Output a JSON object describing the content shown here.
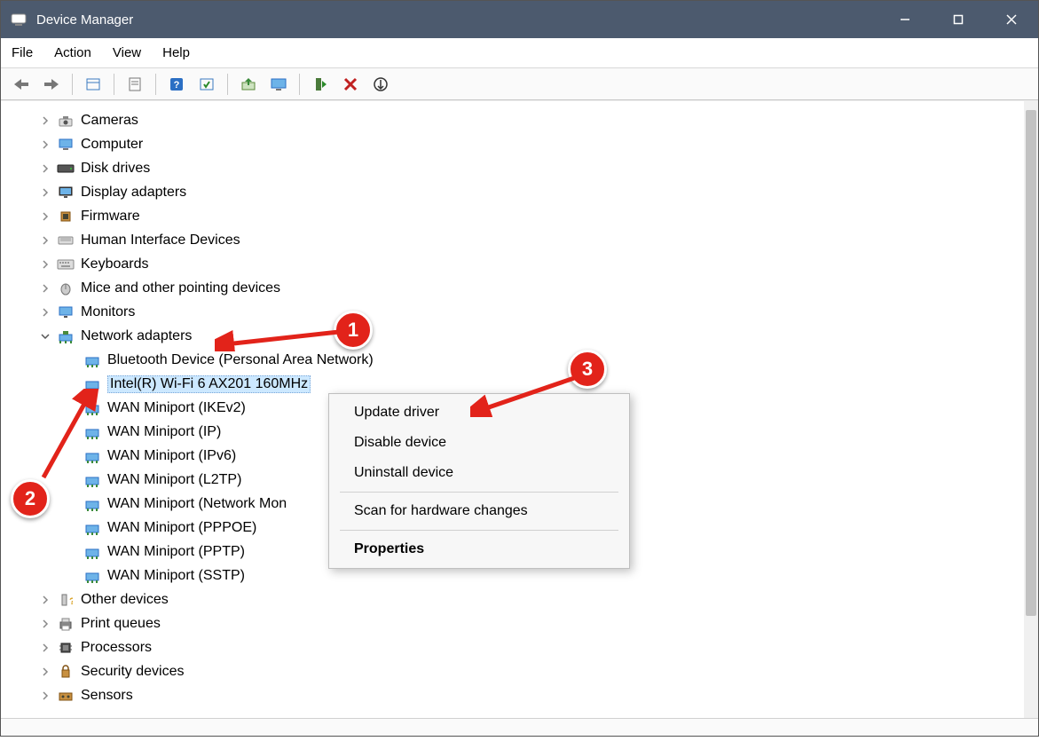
{
  "window": {
    "title": "Device Manager"
  },
  "menu": {
    "file": "File",
    "action": "Action",
    "view": "View",
    "help": "Help"
  },
  "toolbar_icons": [
    "back",
    "forward",
    "show-hidden",
    "properties",
    "help",
    "scan",
    "update-driver",
    "computer",
    "enable",
    "uninstall",
    "events"
  ],
  "tree": {
    "categories": [
      {
        "label": "Cameras",
        "icon": "camera",
        "expandable": true
      },
      {
        "label": "Computer",
        "icon": "computer",
        "expandable": true
      },
      {
        "label": "Disk drives",
        "icon": "disk",
        "expandable": true
      },
      {
        "label": "Display adapters",
        "icon": "display",
        "expandable": true
      },
      {
        "label": "Firmware",
        "icon": "firmware",
        "expandable": true
      },
      {
        "label": "Human Interface Devices",
        "icon": "hid",
        "expandable": true
      },
      {
        "label": "Keyboards",
        "icon": "keyboard",
        "expandable": true
      },
      {
        "label": "Mice and other pointing devices",
        "icon": "mouse",
        "expandable": true
      },
      {
        "label": "Monitors",
        "icon": "monitor",
        "expandable": true
      },
      {
        "label": "Network adapters",
        "icon": "network",
        "expandable": true,
        "expanded": true,
        "children": [
          {
            "label": "Bluetooth Device (Personal Area Network)",
            "icon": "netcard"
          },
          {
            "label": "Intel(R) Wi-Fi 6 AX201 160MHz",
            "icon": "netcard",
            "selected": true
          },
          {
            "label": "WAN Miniport (IKEv2)",
            "icon": "netcard"
          },
          {
            "label": "WAN Miniport (IP)",
            "icon": "netcard"
          },
          {
            "label": "WAN Miniport (IPv6)",
            "icon": "netcard"
          },
          {
            "label": "WAN Miniport (L2TP)",
            "icon": "netcard"
          },
          {
            "label": "WAN Miniport (Network Mon",
            "icon": "netcard"
          },
          {
            "label": "WAN Miniport (PPPOE)",
            "icon": "netcard"
          },
          {
            "label": "WAN Miniport (PPTP)",
            "icon": "netcard"
          },
          {
            "label": "WAN Miniport (SSTP)",
            "icon": "netcard"
          }
        ]
      },
      {
        "label": "Other devices",
        "icon": "other",
        "expandable": true
      },
      {
        "label": "Print queues",
        "icon": "printer",
        "expandable": true
      },
      {
        "label": "Processors",
        "icon": "cpu",
        "expandable": true
      },
      {
        "label": "Security devices",
        "icon": "security",
        "expandable": true
      },
      {
        "label": "Sensors",
        "icon": "sensor",
        "expandable": true
      }
    ]
  },
  "context_menu": {
    "items": [
      {
        "label": "Update driver",
        "type": "item"
      },
      {
        "label": "Disable device",
        "type": "item"
      },
      {
        "label": "Uninstall device",
        "type": "item"
      },
      {
        "type": "sep"
      },
      {
        "label": "Scan for hardware changes",
        "type": "item"
      },
      {
        "type": "sep"
      },
      {
        "label": "Properties",
        "type": "item",
        "bold": true
      }
    ]
  },
  "annotations": {
    "b1": "1",
    "b2": "2",
    "b3": "3"
  }
}
